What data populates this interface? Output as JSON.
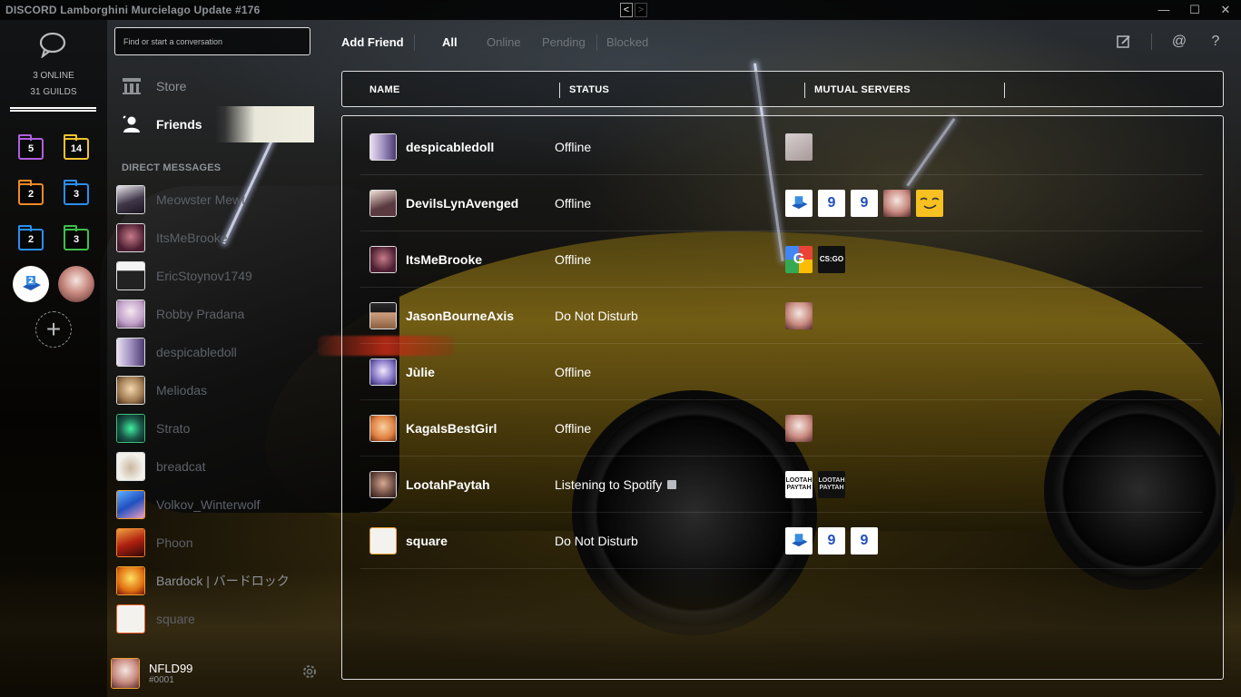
{
  "window": {
    "title": "DISCORD Lamborghini Murcielago Update #176",
    "nav_back": "<",
    "nav_forward": ">",
    "minimize": "—",
    "maximize": "☐",
    "close": "✕"
  },
  "guilds": {
    "online_count": "3 ONLINE",
    "guild_count": "31 GUILDS",
    "folders": [
      {
        "count": "5",
        "color": "#b05fe0"
      },
      {
        "count": "14",
        "color": "#f2c230"
      },
      {
        "count": "2",
        "color": "#f08a24"
      },
      {
        "count": "3",
        "color": "#2a8ff0"
      },
      {
        "count": "2",
        "color": "#2a8ff0"
      },
      {
        "count": "3",
        "color": "#3fbf4a"
      }
    ],
    "add_label": "+"
  },
  "sidebar": {
    "search_placeholder": "Find or start a conversation",
    "store_label": "Store",
    "friends_label": "Friends",
    "dm_header": "DIRECT MESSAGES",
    "dms": [
      "Meowster Mewt",
      "ItsMeBrooke",
      "EricStoynov1749",
      "Robby Pradana",
      "despicabledoll",
      "Meliodas",
      "Strato",
      "breadcat",
      "Volkov_Winterwolf",
      "Phoon",
      "Bardock | バードロック",
      "square"
    ],
    "user": {
      "name": "NFLD99",
      "tag": "#0001"
    }
  },
  "topbar": {
    "add_friend": "Add Friend",
    "tabs": {
      "all": "All",
      "online": "Online",
      "pending": "Pending",
      "blocked": "Blocked"
    }
  },
  "table": {
    "col_name": "NAME",
    "col_status": "STATUS",
    "col_mutual": "MUTUAL SERVERS"
  },
  "friends": [
    {
      "name": "despicabledoll",
      "status": "Offline"
    },
    {
      "name": "DevilsLynAvenged",
      "status": "Offline"
    },
    {
      "name": "ItsMeBrooke",
      "status": "Offline"
    },
    {
      "name": "JasonBourneAxis",
      "status": "Do Not Disturb"
    },
    {
      "name": "Jùlie",
      "status": "Offline"
    },
    {
      "name": "KagaIsBestGirl",
      "status": "Offline"
    },
    {
      "name": "LootahPaytah",
      "status": "Listening to Spotify"
    },
    {
      "name": "square",
      "status": "Do Not Disturb"
    }
  ],
  "mutual_labels": {
    "csgo": "CS:GO",
    "g": "G",
    "nine": "9",
    "lootah": "LOOTAH PAYTAH"
  },
  "colors": {
    "accent_border": "#dcddde",
    "muted": "#72767d",
    "dim_dm": "#5d6168"
  }
}
